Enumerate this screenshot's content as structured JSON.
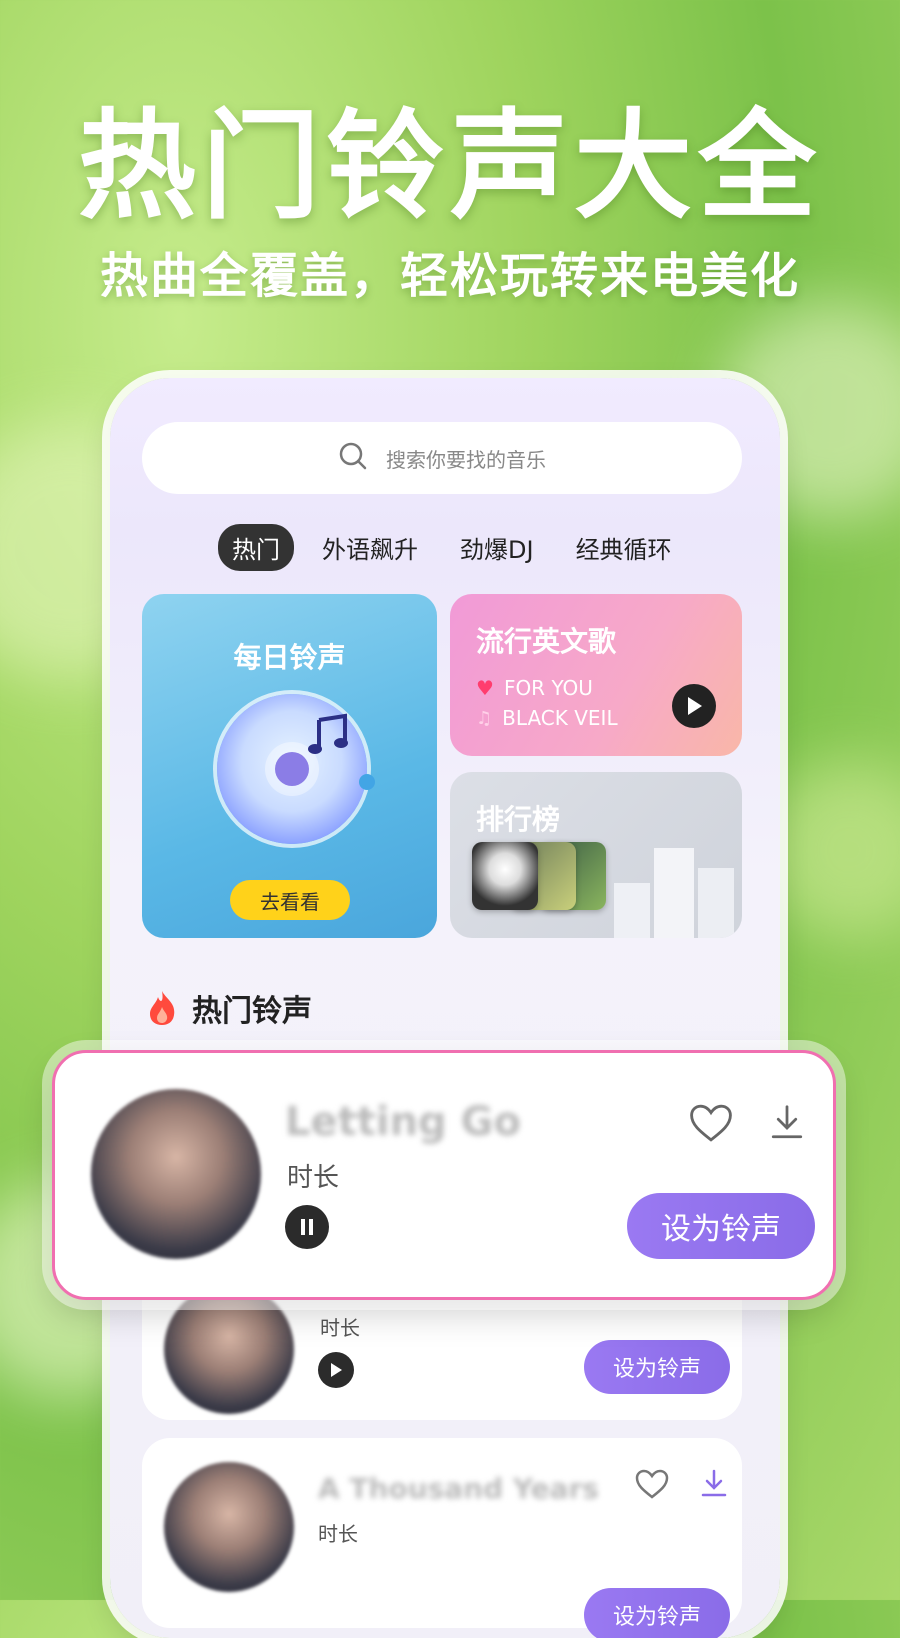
{
  "promo": {
    "headline": "热门铃声大全",
    "subline": "热曲全覆盖，轻松玩转来电美化"
  },
  "search": {
    "placeholder": "搜索你要找的音乐"
  },
  "tabs": [
    {
      "label": "热门",
      "active": true
    },
    {
      "label": "外语飙升",
      "active": false
    },
    {
      "label": "劲爆DJ",
      "active": false
    },
    {
      "label": "经典循环",
      "active": false
    }
  ],
  "cards": {
    "daily": {
      "title": "每日铃声",
      "button": "去看看"
    },
    "pop": {
      "title": "流行英文歌",
      "songs": [
        "FOR YOU",
        "BLACK VEIL"
      ]
    },
    "rank": {
      "title": "排行榜"
    }
  },
  "section": {
    "title": "热门铃声"
  },
  "songs": [
    {
      "title": "Letting Go",
      "duration_label": "时长",
      "state": "playing",
      "action": "设为铃声"
    },
    {
      "title": "",
      "duration_label": "时长",
      "state": "paused",
      "action": "设为铃声"
    },
    {
      "title": "A Thousand Years",
      "duration_label": "时长",
      "state": "paused",
      "action": "设为铃声"
    }
  ],
  "colors": {
    "accent": "#8a6ce8",
    "highlight_border": "#f06fb0",
    "daily_button": "#ffd21a"
  }
}
